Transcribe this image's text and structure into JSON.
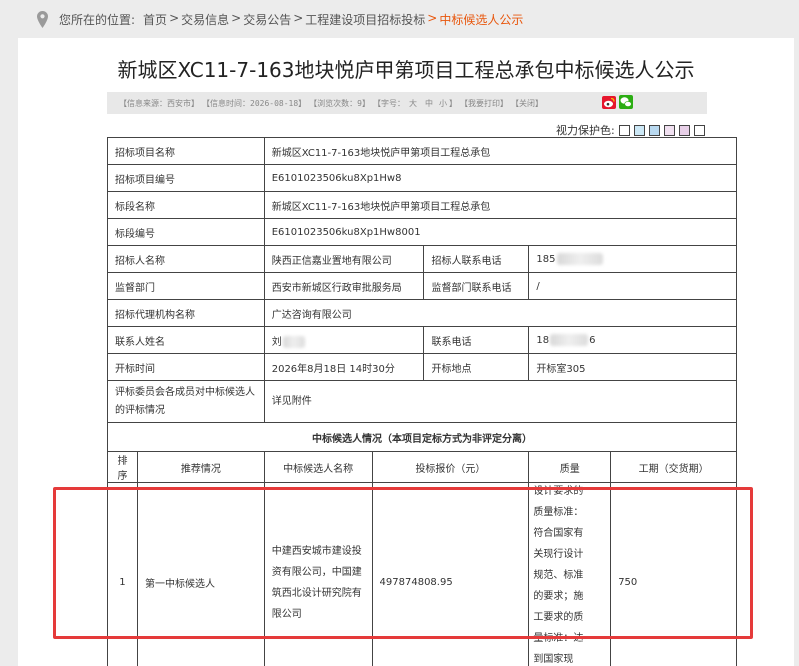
{
  "breadcrumb": {
    "prefix": "您所在的位置:",
    "items": [
      "首页",
      "交易信息",
      "交易公告",
      "工程建设项目招标投标"
    ],
    "separator": ">",
    "current": "中标候选人公示"
  },
  "title": "新城区XC11-7-163地块悦庐甲第项目工程总承包中标候选人公示",
  "infobar": {
    "source": "【信息来源：西安市】",
    "time": "【信息时间：2026-08-18】",
    "views": "【浏览次数：9】",
    "font": "【字号：",
    "size_large": "大",
    "size_mid": "中",
    "size_small": "小",
    "font_end": "】",
    "print": "【我要打印】",
    "close": "【关闭】"
  },
  "vision": {
    "label": "视力保护色:",
    "swatches": [
      "#ffffff",
      "#cce8f6",
      "#b9d9f0",
      "#f0e0f0",
      "#e8d0e8",
      "#ffffff"
    ]
  },
  "rows": [
    {
      "label": "招标项目名称",
      "value": "新城区XC11-7-163地块悦庐甲第项目工程总承包"
    },
    {
      "label": "招标项目编号",
      "value": "E6101023506ku8Xp1Hw8"
    },
    {
      "label": "标段名称",
      "value": "新城区XC11-7-163地块悦庐甲第项目工程总承包"
    },
    {
      "label": "标段编号",
      "value": "E6101023506ku8Xp1Hw8001"
    }
  ],
  "pair_rows": [
    {
      "label1": "招标人名称",
      "value1": "陕西正信嘉业置地有限公司",
      "label2": "招标人联系电话",
      "value2": "185"
    },
    {
      "label1": "监督部门",
      "value1": "西安市新城区行政审批服务局",
      "label2": "监督部门联系电话",
      "value2": "/"
    }
  ],
  "agency": {
    "label": "招标代理机构名称",
    "value": "广达咨询有限公司"
  },
  "contact": {
    "label1": "联系人姓名",
    "value1": "刘",
    "label2": "联系电话",
    "value2a": "18",
    "value2b": "6"
  },
  "opening": {
    "label1": "开标时间",
    "value1": "2026年8月18日 14时30分",
    "label2": "开标地点",
    "value2": "开标室305"
  },
  "evaluation": {
    "label": "评标委员会各成员对中标候选人的评标情况",
    "value": "详见附件"
  },
  "section_title": "中标候选人情况（本项目定标方式为非评定分离）",
  "headers": [
    "排序",
    "推荐情况",
    "中标候选人名称",
    "投标报价（元）",
    "质量",
    "工期（交货期）"
  ],
  "candidate": {
    "rank": "1",
    "recommendation": "第一中标候选人",
    "name": "中建西安城市建设投资有限公司，中国建筑西北设计研究院有限公司",
    "price": "497874808.95",
    "quality": "设计要求的质量标准：符合国家有关现行设计规范、标准的要求；施工要求的质量标准：达到国家现",
    "duration": "750"
  }
}
